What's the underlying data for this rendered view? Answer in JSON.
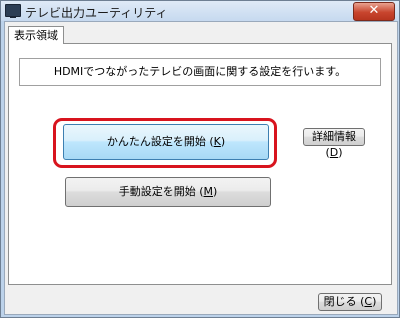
{
  "window": {
    "title": "テレビ出力ユーティリティ",
    "close_glyph": "✕"
  },
  "tab": {
    "label": "表示領域"
  },
  "panel": {
    "info_text": "HDMIでつながったテレビの画面に関する設定を行います。",
    "easy_button": {
      "label": "かんたん設定を開始 (",
      "key": "K",
      "end": ")"
    },
    "detail_button": {
      "label": "詳細情報(",
      "key": "D",
      "end": ")"
    },
    "manual_button": {
      "label": "手動設定を開始 (",
      "key": "M",
      "end": ")"
    }
  },
  "footer": {
    "close_button": {
      "label": "閉じる (",
      "key": "C",
      "end": ")"
    }
  },
  "colors": {
    "highlight": "#d8141e",
    "focused_button_border": "#3c7fb1"
  }
}
